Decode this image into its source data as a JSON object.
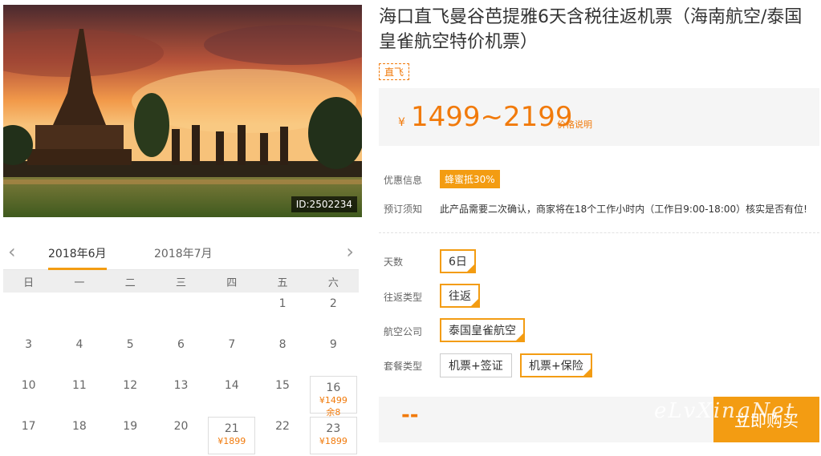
{
  "hero": {
    "id_badge": "ID:2502234"
  },
  "calendar": {
    "months": [
      "2018年6月",
      "2018年7月"
    ],
    "prev_icon": "chevron-left-icon",
    "next_icon": "chevron-right-icon",
    "weekdays": [
      "日",
      "一",
      "二",
      "三",
      "四",
      "五",
      "六"
    ],
    "days": [
      {
        "d": ""
      },
      {
        "d": ""
      },
      {
        "d": ""
      },
      {
        "d": ""
      },
      {
        "d": ""
      },
      {
        "d": "1"
      },
      {
        "d": "2"
      },
      {
        "d": "3"
      },
      {
        "d": "4"
      },
      {
        "d": "5"
      },
      {
        "d": "6"
      },
      {
        "d": "7"
      },
      {
        "d": "8"
      },
      {
        "d": "9"
      },
      {
        "d": "10"
      },
      {
        "d": "11"
      },
      {
        "d": "12"
      },
      {
        "d": "13"
      },
      {
        "d": "14"
      },
      {
        "d": "15"
      },
      {
        "d": "16",
        "price": "¥1499",
        "remain": "余8"
      },
      {
        "d": "17"
      },
      {
        "d": "18"
      },
      {
        "d": "19"
      },
      {
        "d": "20"
      },
      {
        "d": "21",
        "price": "¥1899"
      },
      {
        "d": "22"
      },
      {
        "d": "23",
        "price": "¥1899"
      }
    ]
  },
  "product": {
    "title": "海口直飞曼谷芭提雅6天含税往返机票（海南航空/泰国皇雀航空特价机票）",
    "tag": "直飞",
    "currency": "¥",
    "price_range": "1499~2199",
    "price_note": "价格说明",
    "promo_label": "优惠信息",
    "promo_badge": "蜂蜜抵30%",
    "notice_label": "预订须知",
    "notice_text": "此产品需要二次确认，商家将在18个工作小时内（工作日9:00-18:00）核实是否有位!",
    "days_label": "天数",
    "days_value": "6日",
    "trip_label": "往返类型",
    "trip_value": "往返",
    "airline_label": "航空公司",
    "airline_value": "泰国皇雀航空",
    "package_label": "套餐类型",
    "package_options": [
      "机票+签证",
      "机票+保险"
    ],
    "total": "--",
    "buy_label": "立即购买"
  },
  "watermark": "eLvXingNet",
  "colors": {
    "accent": "#f39c12",
    "price": "#f17a0b"
  }
}
